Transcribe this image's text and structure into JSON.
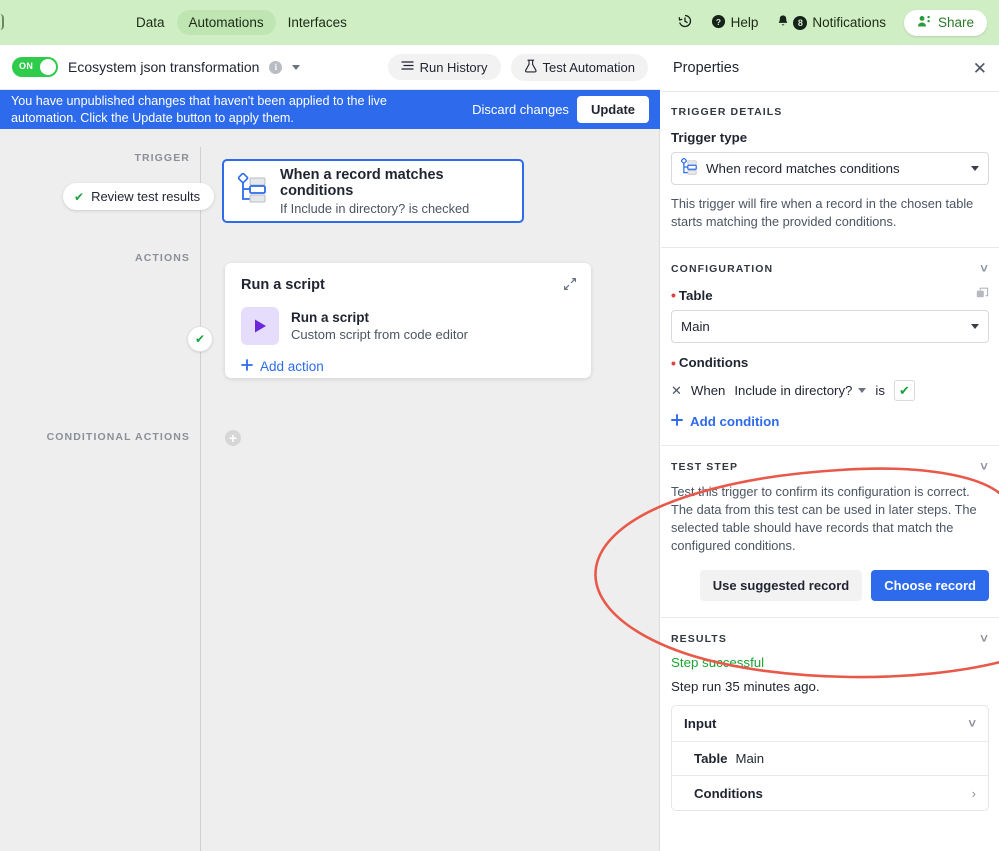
{
  "topbar": {
    "tabs": [
      {
        "label": "Data",
        "active": false
      },
      {
        "label": "Automations",
        "active": true
      },
      {
        "label": "Interfaces",
        "active": false
      }
    ],
    "history_icon": "history-clock-icon",
    "help_label": "Help",
    "help_icon": "question-circle-icon",
    "notifications_label": "Notifications",
    "notifications_icon": "bell-icon",
    "notifications_count": "8",
    "share_label": "Share",
    "share_icon": "people-icon",
    "bg_color": "#cfeec4",
    "accent_color": "#2a7a2a"
  },
  "subheader": {
    "toggle_state": "ON",
    "automation_title": "Ecosystem json transformation",
    "info_icon": "info-circle-icon",
    "caret_icon": "chevron-down-icon",
    "run_history_label": "Run History",
    "run_history_icon": "list-icon",
    "test_automation_label": "Test Automation",
    "test_automation_icon": "flask-icon"
  },
  "banner": {
    "message": "You have unpublished changes that haven't been applied to the live automation. Click the Update button to apply them.",
    "discard_label": "Discard changes",
    "update_label": "Update",
    "color": "#2d6bec"
  },
  "canvas": {
    "trigger_section_label": "TRIGGER",
    "actions_section_label": "ACTIONS",
    "conditional_section_label": "CONDITIONAL ACTIONS",
    "review_chip_label": "Review test results",
    "review_chip_icon": "check-icon",
    "trigger_card": {
      "icon": "record-matches-conditions-icon",
      "title": "When a record matches conditions",
      "subtitle": "If Include in directory? is checked"
    },
    "action_card": {
      "title": "Run a script",
      "expand_icon": "expand-diagonal-icon",
      "item_icon": "play-triangle-icon",
      "item_name": "Run a script",
      "item_desc": "Custom script from code editor",
      "add_action_label": "Add action",
      "add_icon": "plus-icon"
    },
    "conditional_add_icon": "plus-circle-icon",
    "node_check_icon": "check-icon"
  },
  "properties": {
    "title": "Properties",
    "close_icon": "close-icon",
    "trigger_details": {
      "section_label": "TRIGGER DETAILS",
      "field_label": "Trigger type",
      "selected": "When record matches conditions",
      "select_icon": "record-matches-conditions-icon",
      "caret_icon": "chevron-down-icon",
      "helper": "This trigger will fire when a record in the chosen table starts matching the provided conditions."
    },
    "configuration": {
      "section_label": "CONFIGURATION",
      "collapse_icon": "chevron-down-icon",
      "expand_icon": "open-external-icon",
      "table_label": "Table",
      "table_value": "Main",
      "conditions_label": "Conditions",
      "condition_row": {
        "remove_icon": "close-icon",
        "when_label": "When",
        "field": "Include in directory?",
        "field_caret": "chevron-down-icon",
        "operator": "is",
        "value_checked": true,
        "value_icon": "check-icon"
      },
      "add_condition_label": "Add condition",
      "add_condition_icon": "plus-icon"
    },
    "test_step": {
      "section_label": "TEST STEP",
      "collapse_icon": "chevron-down-icon",
      "helper": "Test this trigger to confirm its configuration is correct. The data from this test can be used in later steps. The selected table should have records that match the configured conditions.",
      "secondary_button": "Use suggested record",
      "primary_button": "Choose record"
    },
    "results": {
      "section_label": "RESULTS",
      "collapse_icon": "chevron-down-icon",
      "status": "Step successful",
      "status_color": "#1aa432",
      "run_time": "Step run 35 minutes ago.",
      "input_label": "Input",
      "input_chevron": "chevron-down-icon",
      "rows": [
        {
          "key": "Table",
          "value": "Main",
          "chevron": ""
        },
        {
          "key": "Conditions",
          "value": "",
          "chevron": "chevron-right-icon"
        }
      ]
    }
  },
  "annotation": {
    "shape": "ellipse",
    "color": "#e8594a",
    "description": "Hand-drawn red ellipse highlighting the Test step section"
  }
}
